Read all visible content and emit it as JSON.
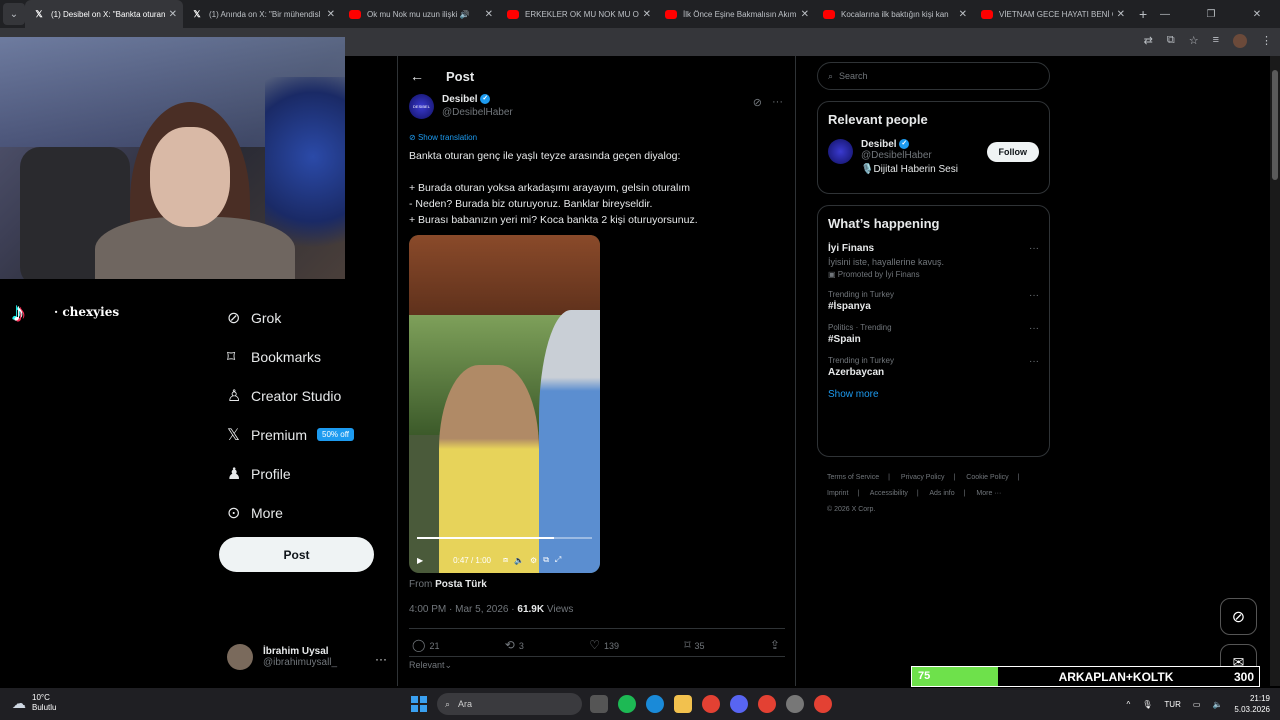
{
  "browser": {
    "tabs": [
      {
        "title": "(1) Desibel on X: \"Bankta oturan",
        "icon": "x-icon",
        "active": true
      },
      {
        "title": "(1) Anında on X: \"Bir mühendisl",
        "icon": "x-icon",
        "active": false
      },
      {
        "title": "Ok mu Nok mu uzun ilişki 🔊",
        "icon": "youtube-icon",
        "active": false
      },
      {
        "title": "ERKEKLER OK MU NOK MU OY",
        "icon": "youtube-icon",
        "active": false
      },
      {
        "title": "İlk Önce Eşine Bakmalısın Akım",
        "icon": "youtube-icon",
        "active": false
      },
      {
        "title": "Kocalarına ilk baktığın kişi kan",
        "icon": "youtube-icon",
        "active": false
      },
      {
        "title": "VİETNAM GECE HAYATI BENİ Ç",
        "icon": "youtube-icon",
        "active": false
      }
    ],
    "new_tab": "+"
  },
  "stream": {
    "platform_icon": "tiktok-icon",
    "username": "· chexyies"
  },
  "sidenav": {
    "items": [
      {
        "label": "Grok",
        "icon": "grok-icon"
      },
      {
        "label": "Bookmarks",
        "icon": "bookmark-icon"
      },
      {
        "label": "Creator Studio",
        "icon": "creator-studio-icon"
      },
      {
        "label": "Premium",
        "icon": "x-logo-icon",
        "badge": "50% off"
      },
      {
        "label": "Profile",
        "icon": "person-icon"
      },
      {
        "label": "More",
        "icon": "more-circle-icon"
      }
    ],
    "post_button": "Post",
    "account": {
      "name": "İbrahim Uysal",
      "handle": "@ibrahimuysall_"
    }
  },
  "post": {
    "header": "Post",
    "author_name": "Desibel",
    "author_handle": "@DesibelHaber",
    "avatar_text": "DESIBEL",
    "show_translation": "Show translation",
    "lines": [
      "Bankta oturan genç ile yaşlı teyze arasında geçen diyalog:",
      "",
      "+ Burada oturan yoksa arkadaşımı arayayım, gelsin oturalım",
      "- Neden? Burada biz oturuyoruz. Banklar bireyseldir.",
      "+ Burası babanızın yeri mi? Koca bankta 2 kişi oturuyorsunuz."
    ],
    "video": {
      "time": "0:47 / 1:00",
      "progress": 0.78
    },
    "from_label": "From",
    "from_source": "Posta Türk",
    "timestamp": "4:00 PM · Mar 5, 2026 ·",
    "views_count": "61.9K",
    "views_label": "Views",
    "replies": "21",
    "reposts": "3",
    "likes": "139",
    "bookmarks": "35",
    "relevant_label": "Relevant"
  },
  "right": {
    "search_placeholder": "Search",
    "relevant_people": {
      "title": "Relevant people",
      "name": "Desibel",
      "handle": "@DesibelHaber",
      "bio": "🎙️Dijital Haberin Sesi",
      "follow": "Follow"
    },
    "happening": {
      "title": "What’s happening",
      "promo": {
        "title": "İyi Finans",
        "subtitle": "İyisini iste, hayallerine kavuş.",
        "promoted": "Promoted by İyi Finans"
      },
      "trends": [
        {
          "context": "Trending in Turkey",
          "title": "#İspanya"
        },
        {
          "context": "Politics · Trending",
          "title": "#Spain"
        },
        {
          "context": "Trending in Turkey",
          "title": "Azerbaycan"
        }
      ],
      "show_more": "Show more"
    },
    "footer": [
      "Terms of Service",
      "|",
      "Privacy Policy",
      "|",
      "Cookie Policy",
      "|",
      "Imprint",
      "|",
      "Accessibility",
      "|",
      "Ads info",
      "|",
      "More ···",
      "© 2026 X Corp."
    ]
  },
  "overlay": {
    "left_value": "75",
    "label": "ARKAPLAN+KOLTK",
    "right_value": "300",
    "accent": "#6ee14b"
  },
  "taskbar": {
    "weather_temp": "10°C",
    "weather_desc": "Bulutlu",
    "search_placeholder": "Ara",
    "lang": "TUR",
    "time": "21:19",
    "date": "5.03.2026"
  }
}
